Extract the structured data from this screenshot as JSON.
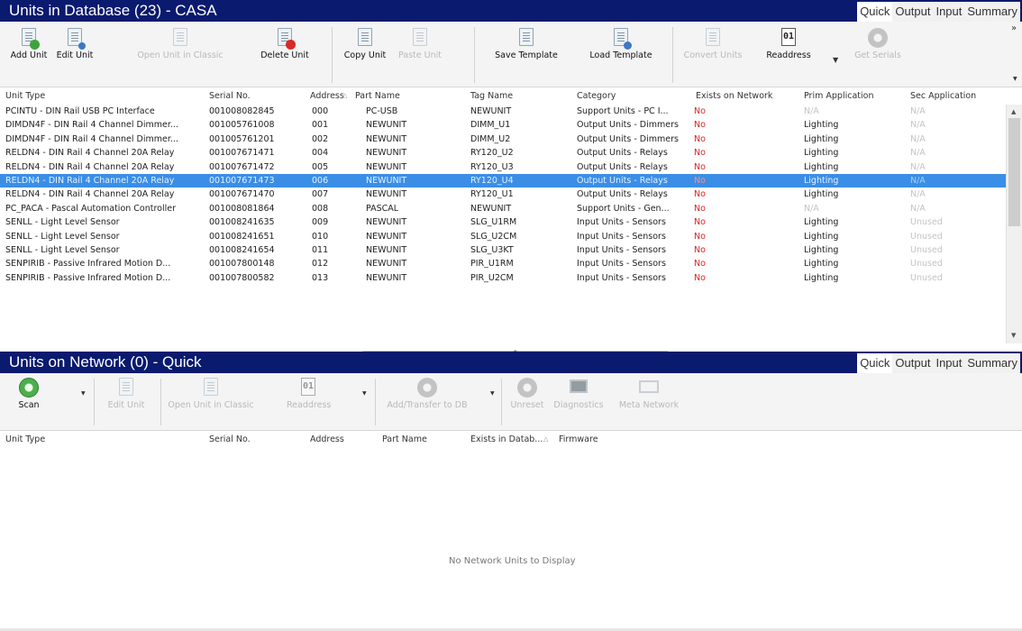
{
  "top_panel": {
    "title": "Units in Database (23) - CASA",
    "tabs": [
      "Quick",
      "Output",
      "Input",
      "Summary"
    ],
    "toolbar": {
      "add_unit": "Add Unit",
      "edit_unit": "Edit Unit",
      "open_unit_in_classic": "Open Unit in Classic",
      "delete_unit": "Delete Unit",
      "copy_unit": "Copy Unit",
      "paste_unit": "Paste Unit",
      "save_template": "Save Template",
      "load_template": "Load Template",
      "convert_units": "Convert Units",
      "readdress": "Readdress",
      "get_serials": "Get Serials",
      "readdress_icon_text": "01"
    },
    "columns": [
      "Unit Type",
      "Serial No.",
      "Address",
      "Part Name",
      "Tag Name",
      "Category",
      "Exists on Network",
      "Prim Application",
      "Sec Application"
    ],
    "rows": [
      {
        "unit_type": "PCINTU - DIN Rail USB PC Interface",
        "serial": "001008082845",
        "address": "000",
        "part": "PC-USB",
        "tag": "NEWUNIT",
        "category": "Support Units - PC I...",
        "exists": "No",
        "prim": "N/A",
        "sec": "N/A"
      },
      {
        "unit_type": "DIMDN4F - DIN Rail 4 Channel Dimmer...",
        "serial": "001005761008",
        "address": "001",
        "part": "NEWUNIT",
        "tag": "DIMM_U1",
        "category": "Output Units - Dimmers",
        "exists": "No",
        "prim": "Lighting",
        "sec": "N/A"
      },
      {
        "unit_type": "DIMDN4F - DIN Rail 4 Channel Dimmer...",
        "serial": "001005761201",
        "address": "002",
        "part": "NEWUNIT",
        "tag": "DIMM_U2",
        "category": "Output Units - Dimmers",
        "exists": "No",
        "prim": "Lighting",
        "sec": "N/A"
      },
      {
        "unit_type": "RELDN4 - DIN Rail 4 Channel 20A Relay",
        "serial": "001007671471",
        "address": "004",
        "part": "NEWUNIT",
        "tag": "RY120_U2",
        "category": "Output Units - Relays",
        "exists": "No",
        "prim": "Lighting",
        "sec": "N/A"
      },
      {
        "unit_type": "RELDN4 - DIN Rail 4 Channel 20A Relay",
        "serial": "001007671472",
        "address": "005",
        "part": "NEWUNIT",
        "tag": "RY120_U3",
        "category": "Output Units - Relays",
        "exists": "No",
        "prim": "Lighting",
        "sec": "N/A"
      },
      {
        "unit_type": "RELDN4 - DIN Rail 4 Channel 20A Relay",
        "serial": "001007671473",
        "address": "006",
        "part": "NEWUNIT",
        "tag": "RY120_U4",
        "category": "Output Units - Relays",
        "exists": "No",
        "prim": "Lighting",
        "sec": "N/A"
      },
      {
        "unit_type": "RELDN4 - DIN Rail 4 Channel 20A Relay",
        "serial": "001007671470",
        "address": "007",
        "part": "NEWUNIT",
        "tag": "RY120_U1",
        "category": "Output Units - Relays",
        "exists": "No",
        "prim": "Lighting",
        "sec": "N/A"
      },
      {
        "unit_type": "PC_PACA - Pascal Automation Controller",
        "serial": "001008081864",
        "address": "008",
        "part": "PASCAL",
        "tag": "NEWUNIT",
        "category": "Support Units - Gen...",
        "exists": "No",
        "prim": "N/A",
        "sec": "N/A"
      },
      {
        "unit_type": "SENLL - Light Level Sensor",
        "serial": "001008241635",
        "address": "009",
        "part": "NEWUNIT",
        "tag": "SLG_U1RM",
        "category": "Input Units - Sensors",
        "exists": "No",
        "prim": "Lighting",
        "sec": "Unused"
      },
      {
        "unit_type": "SENLL - Light Level Sensor",
        "serial": "001008241651",
        "address": "010",
        "part": "NEWUNIT",
        "tag": "SLG_U2CM",
        "category": "Input Units - Sensors",
        "exists": "No",
        "prim": "Lighting",
        "sec": "Unused"
      },
      {
        "unit_type": "SENLL - Light Level Sensor",
        "serial": "001008241654",
        "address": "011",
        "part": "NEWUNIT",
        "tag": "SLG_U3KT",
        "category": "Input Units - Sensors",
        "exists": "No",
        "prim": "Lighting",
        "sec": "Unused"
      },
      {
        "unit_type": "SENPIRIB - Passive Infrared Motion D...",
        "serial": "001007800148",
        "address": "012",
        "part": "NEWUNIT",
        "tag": "PIR_U1RM",
        "category": "Input Units - Sensors",
        "exists": "No",
        "prim": "Lighting",
        "sec": "Unused"
      },
      {
        "unit_type": "SENPIRIB - Passive Infrared Motion D...",
        "serial": "001007800582",
        "address": "013",
        "part": "NEWUNIT",
        "tag": "PIR_U2CM",
        "category": "Input Units - Sensors",
        "exists": "No",
        "prim": "Lighting",
        "sec": "Unused"
      }
    ],
    "selected_row_index": 5
  },
  "bottom_panel": {
    "title": "Units on Network (0) - Quick",
    "tabs": [
      "Quick",
      "Output",
      "Input",
      "Summary"
    ],
    "toolbar": {
      "scan": "Scan",
      "edit_unit": "Edit Unit",
      "open_unit_in_classic": "Open Unit in Classic",
      "readdress": "Readdress",
      "add_transfer_to_db": "Add/Transfer to DB",
      "unreset": "Unreset",
      "diagnostics": "Diagnostics",
      "meta_network": "Meta Network",
      "readdress_icon_text": "01"
    },
    "columns": [
      "Unit Type",
      "Serial No.",
      "Address",
      "Part Name",
      "Exists in Datab...",
      "Firmware"
    ],
    "empty_message": "No Network Units to Display"
  },
  "colors": {
    "header_bg": "#0a1a6e",
    "selection": "#3a8ee6",
    "no_text": "#dd2222"
  },
  "icons": {
    "vscroll_up": "▲",
    "vscroll_down": "▼",
    "hscroll_left": "◀",
    "hscroll_right": "▶",
    "splitter_grip": "^",
    "dropdown": "▼",
    "sort_indicator": "△",
    "overflow": "»"
  }
}
